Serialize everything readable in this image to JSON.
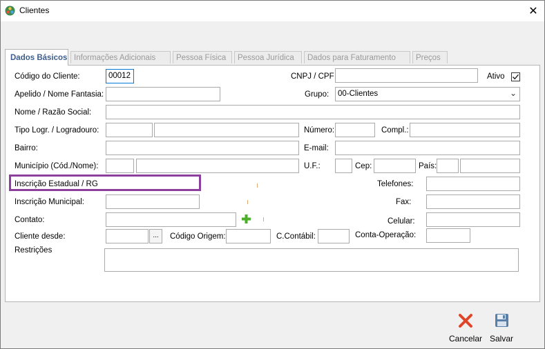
{
  "window": {
    "title": "Clientes"
  },
  "tabs": [
    {
      "label": "Dados Básicos"
    },
    {
      "label": "Informações Adicionais"
    },
    {
      "label": "Pessoa Física"
    },
    {
      "label": "Pessoa Jurídica"
    },
    {
      "label": "Dados para Faturamento"
    },
    {
      "label": "Preços"
    }
  ],
  "form": {
    "codigo_label": "Código do Cliente:",
    "codigo_value": "00012",
    "cnpj_label": "CNPJ / CPF",
    "cnpj_value": "",
    "ativo_label": "Ativo",
    "ativo_checked": true,
    "apelido_label": "Apelido / Nome Fantasia:",
    "grupo_label": "Grupo:",
    "grupo_value": "00-Clientes",
    "nome_label": "Nome / Razão Social:",
    "tipo_label": "Tipo Logr. / Logradouro:",
    "numero_label": "Número:",
    "compl_label": "Compl.:",
    "bairro_label": "Bairro:",
    "email_label": "E-mail:",
    "municipio_label": "Município (Cód./Nome):",
    "uf_label": "U.F.:",
    "cep_label": "Cep:",
    "pais_label": "País:",
    "inscricao_estadual_label": "Inscrição Estadual / RG",
    "telefones_label": "Telefones:",
    "inscricao_municipal_label": "Inscrição Municipal:",
    "fax_label": "Fax:",
    "contato_label": "Contato:",
    "celular_label": "Celular:",
    "cliente_desde_label": "Cliente desde:",
    "ellipsis": "...",
    "codigo_origem_label": "Código Origem:",
    "contabil_label": "C.Contábil:",
    "conta_operacao_label": "Conta-Operação:",
    "restricoes_label": "Restrições"
  },
  "actions": {
    "cancelar": "Cancelar",
    "salvar": "Salvar"
  },
  "colors": {
    "active_tab_text": "#3d5e8c",
    "highlight_border": "#8d3f9e",
    "cancel_icon": "#e0452a",
    "save_icon": "#5a7fa8",
    "add_icon": "#4caf2a"
  }
}
